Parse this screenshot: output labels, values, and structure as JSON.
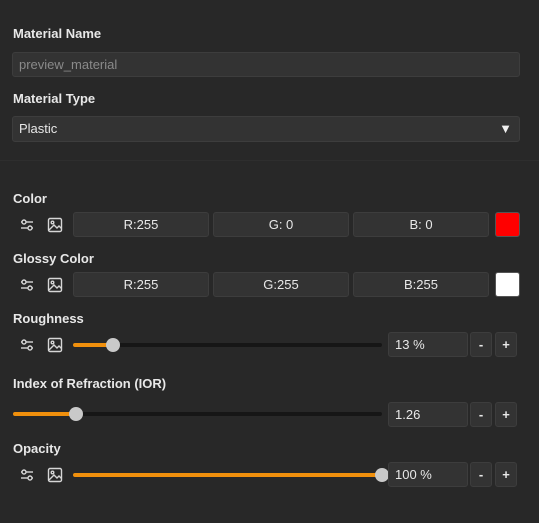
{
  "material_name": {
    "label": "Material Name",
    "value": "preview_material"
  },
  "material_type": {
    "label": "Material Type",
    "selected": "Plastic"
  },
  "color": {
    "label": "Color",
    "r": "R:255",
    "g": "G:  0",
    "b": "B:  0",
    "swatch": "#ff0000"
  },
  "glossy_color": {
    "label": "Glossy Color",
    "r": "R:255",
    "g": "G:255",
    "b": "B:255",
    "swatch": "#ffffff"
  },
  "roughness": {
    "label": "Roughness",
    "value": "13 %",
    "percent": 13,
    "minus": "-",
    "plus": "+"
  },
  "ior": {
    "label": "Index of Refraction (IOR)",
    "value": "1.26",
    "fraction": 0.17,
    "minus": "-",
    "plus": "+"
  },
  "opacity": {
    "label": "Opacity",
    "value": "100 %",
    "percent": 100,
    "minus": "-",
    "plus": "+"
  },
  "accent": "#f0900d"
}
